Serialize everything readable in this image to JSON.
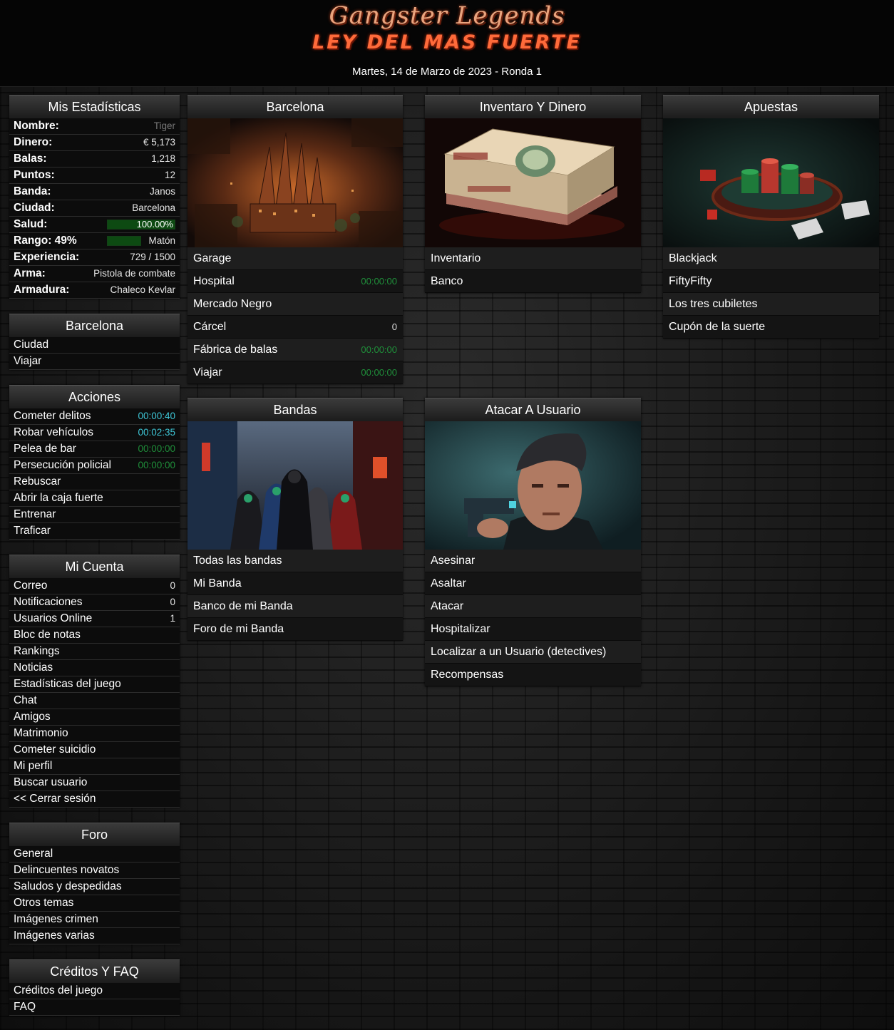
{
  "header": {
    "title": "Gangster Legends",
    "subtitle": "LEY DEL MAS FUERTE",
    "date": "Martes, 14 de Marzo de 2023 - Ronda 1"
  },
  "stats": {
    "title": "Mis Estadísticas",
    "rows": [
      {
        "label": "Nombre:",
        "value": "Tiger"
      },
      {
        "label": "Dinero:",
        "value": "€ 5,173"
      },
      {
        "label": "Balas:",
        "value": "1,218"
      },
      {
        "label": "Puntos:",
        "value": "12"
      },
      {
        "label": "Banda:",
        "value": "Janos"
      },
      {
        "label": "Ciudad:",
        "value": "Barcelona"
      },
      {
        "label": "Salud:",
        "value": "100.00%"
      },
      {
        "label": "Rango: 49%",
        "value": "Matón"
      },
      {
        "label": "Experiencia:",
        "value": "729 / 1500"
      },
      {
        "label": "Arma:",
        "value": "Pistola de combate"
      },
      {
        "label": "Armadura:",
        "value": "Chaleco Kevlar"
      }
    ],
    "health_fraction": 1.0,
    "rank_fraction": 0.49
  },
  "city_menu": {
    "title": "Barcelona",
    "items": [
      "Ciudad",
      "Viajar"
    ]
  },
  "actions": {
    "title": "Acciones",
    "items": [
      {
        "label": "Cometer delitos",
        "timer": "00:00:40"
      },
      {
        "label": "Robar vehículos",
        "timer": "00:02:35"
      },
      {
        "label": "Pelea de bar",
        "timer": "00:00:00"
      },
      {
        "label": "Persecución policial",
        "timer": "00:00:00"
      },
      {
        "label": "Rebuscar",
        "timer": ""
      },
      {
        "label": "Abrir la caja fuerte",
        "timer": ""
      },
      {
        "label": "Entrenar",
        "timer": ""
      },
      {
        "label": "Traficar",
        "timer": ""
      }
    ]
  },
  "account": {
    "title": "Mi Cuenta",
    "items": [
      {
        "label": "Correo",
        "count": "0"
      },
      {
        "label": "Notificaciones",
        "count": "0"
      },
      {
        "label": "Usuarios Online",
        "count": "1"
      },
      {
        "label": "Bloc de notas",
        "count": ""
      },
      {
        "label": "Rankings",
        "count": ""
      },
      {
        "label": "Noticias",
        "count": ""
      },
      {
        "label": "Estadísticas del juego",
        "count": ""
      },
      {
        "label": "Chat",
        "count": ""
      },
      {
        "label": "Amigos",
        "count": ""
      },
      {
        "label": "Matrimonio",
        "count": ""
      },
      {
        "label": "Cometer suicidio",
        "count": ""
      },
      {
        "label": "Mi perfil",
        "count": ""
      },
      {
        "label": "Buscar usuario",
        "count": ""
      },
      {
        "label": "<< Cerrar sesión",
        "count": ""
      }
    ]
  },
  "forum": {
    "title": "Foro",
    "items": [
      "General",
      "Delincuentes novatos",
      "Saludos y despedidas",
      "Otros temas",
      "Imágenes crimen",
      "Imágenes varias"
    ]
  },
  "credits": {
    "title": "Créditos Y FAQ",
    "items": [
      "Créditos del juego",
      "FAQ"
    ]
  },
  "cards": {
    "barcelona": {
      "title": "Barcelona",
      "image": "city-aerial-image",
      "rows": [
        {
          "label": "Garage",
          "timer": ""
        },
        {
          "label": "Hospital",
          "timer": "00:00:00"
        },
        {
          "label": "Mercado Negro",
          "timer": ""
        },
        {
          "label": "Cárcel",
          "timer": "0"
        },
        {
          "label": "Fábrica de balas",
          "timer": "00:00:00"
        },
        {
          "label": "Viajar",
          "timer": "00:00:00"
        }
      ]
    },
    "inventory": {
      "title": "Inventaro Y Dinero",
      "image": "money-stack-image",
      "rows": [
        {
          "label": "Inventario",
          "timer": ""
        },
        {
          "label": "Banco",
          "timer": ""
        }
      ]
    },
    "bets": {
      "title": "Apuestas",
      "image": "casino-chips-image",
      "rows": [
        {
          "label": "Blackjack",
          "timer": ""
        },
        {
          "label": "FiftyFifty",
          "timer": ""
        },
        {
          "label": "Los tres cubiletes",
          "timer": ""
        },
        {
          "label": "Cupón de la suerte",
          "timer": ""
        }
      ]
    },
    "gangs": {
      "title": "Bandas",
      "image": "hooded-gang-image",
      "rows": [
        {
          "label": "Todas las bandas",
          "timer": ""
        },
        {
          "label": "Mi Banda",
          "timer": ""
        },
        {
          "label": "Banco de mi Banda",
          "timer": ""
        },
        {
          "label": "Foro de mi Banda",
          "timer": ""
        }
      ]
    },
    "attack": {
      "title": "Atacar A Usuario",
      "image": "gunman-portrait-image",
      "rows": [
        {
          "label": "Asesinar",
          "timer": ""
        },
        {
          "label": "Asaltar",
          "timer": ""
        },
        {
          "label": "Atacar",
          "timer": ""
        },
        {
          "label": "Hospitalizar",
          "timer": ""
        },
        {
          "label": "Localizar a un Usuario (detectives)",
          "timer": ""
        },
        {
          "label": "Recompensas",
          "timer": ""
        }
      ]
    }
  }
}
